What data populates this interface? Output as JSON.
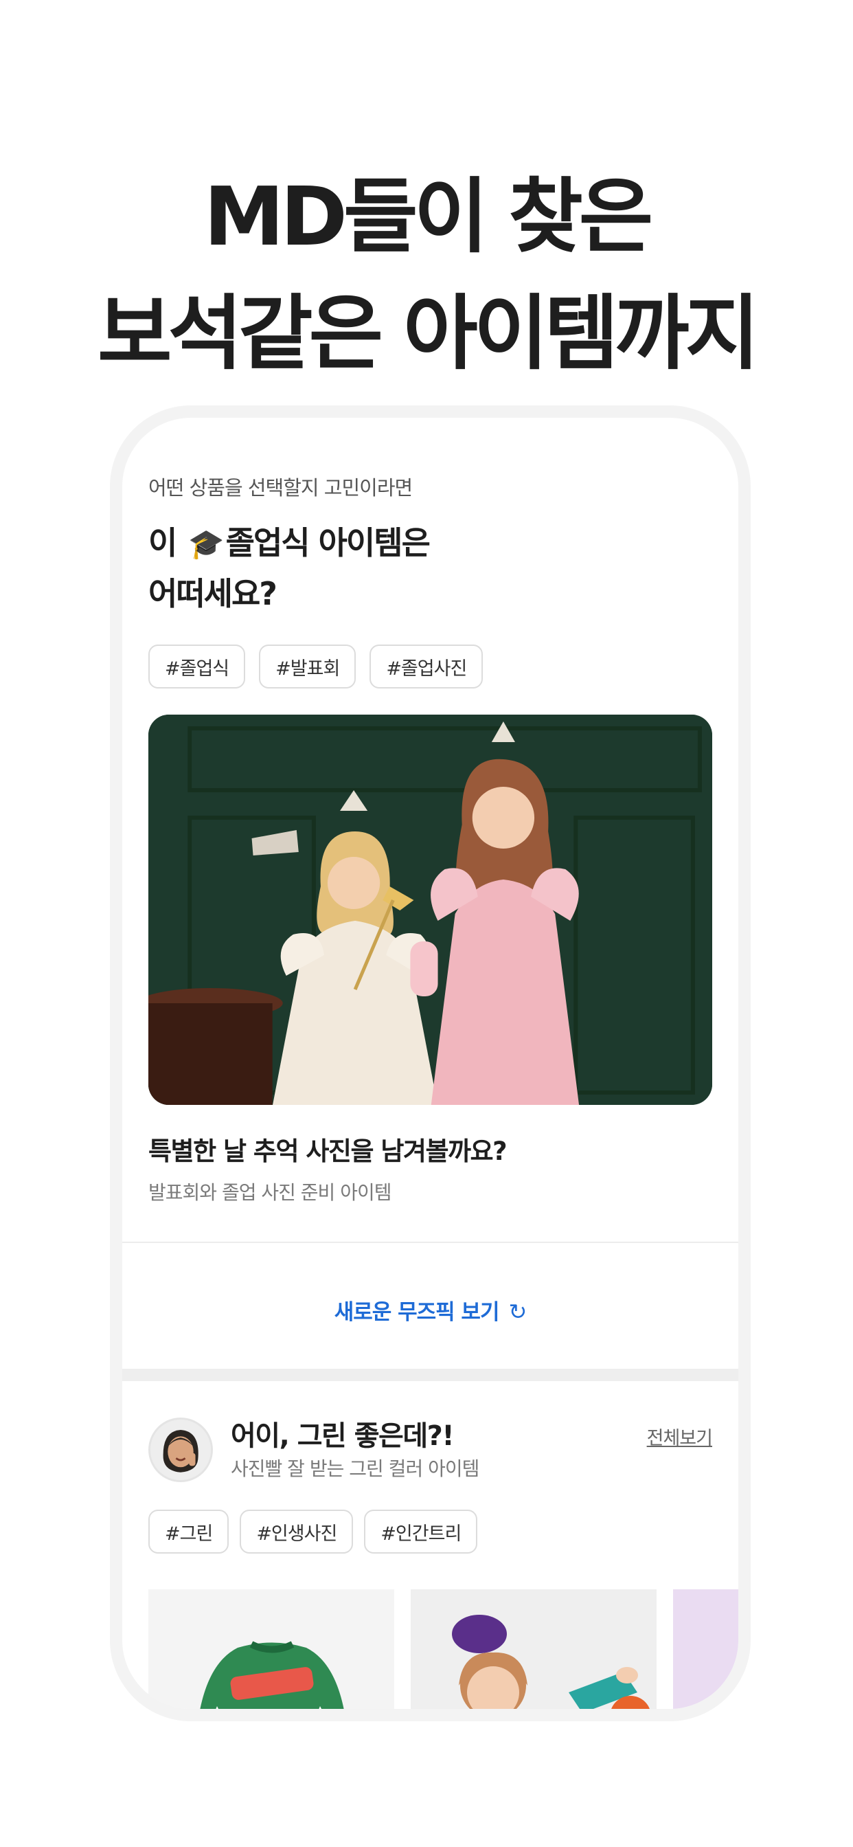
{
  "hero": {
    "line1": "MD들이 찾은",
    "line2": "보석같은 아이템까지"
  },
  "section1": {
    "eyebrow": "어떤 상품을 선택할지 고민이라면",
    "title_prefix": "이",
    "title_emoji": "🎓",
    "title_suffix": "졸업식 아이템은",
    "title_line2": "어떠세요?",
    "tags": [
      "#졸업식",
      "#발표회",
      "#졸업사진"
    ],
    "caption_title": "특별한 날 추억 사진을 남겨볼까요?",
    "caption_sub": "발표회와 졸업 사진 준비 아이템"
  },
  "refresh": {
    "label": "새로운 무즈픽 보기",
    "icon": "refresh-icon"
  },
  "section2": {
    "title": "어이, 그린 좋은데?!",
    "subtitle": "사진빨 잘 받는 그린 컬러 아이템",
    "see_all": "전체보기",
    "tags": [
      "#그린",
      "#인생사진",
      "#인간트리"
    ]
  },
  "colors": {
    "accent": "#1e6bd6",
    "text": "#1e1e1e",
    "muted": "#7a7a7a"
  }
}
